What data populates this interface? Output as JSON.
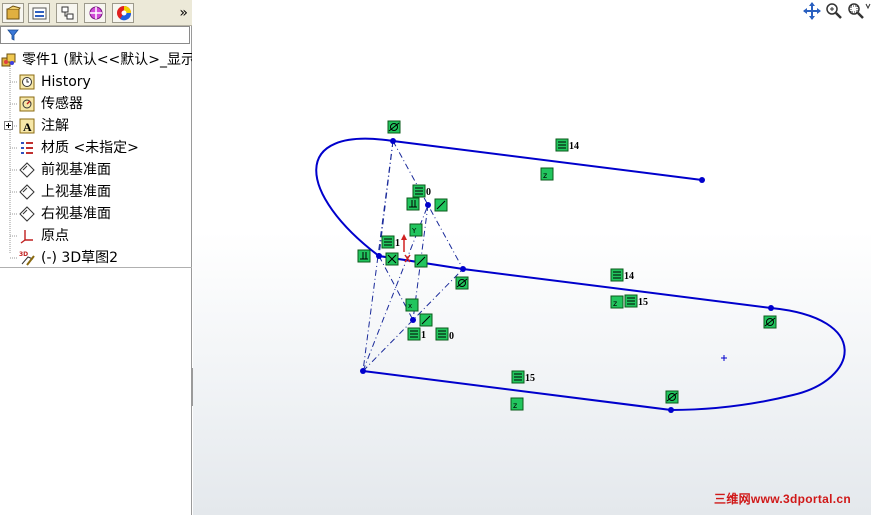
{
  "feature_manager": {
    "tabs": [
      {
        "name": "featuremanager-tab"
      },
      {
        "name": "propertymanager-tab"
      },
      {
        "name": "configurationmanager-tab"
      },
      {
        "name": "dimxpert-tab"
      },
      {
        "name": "display-manager-tab"
      }
    ],
    "expand_glyph": "»",
    "part_label": "零件1  (默认<<默认>_显示",
    "items": [
      {
        "label": "History",
        "icon": "history-icon"
      },
      {
        "label": "传感器",
        "icon": "sensor-icon"
      },
      {
        "label": "注解",
        "icon": "annotation-icon"
      },
      {
        "label": "材质 <未指定>",
        "icon": "material-icon"
      },
      {
        "label": "前视基准面",
        "icon": "plane-icon"
      },
      {
        "label": "上视基准面",
        "icon": "plane-icon"
      },
      {
        "label": "右视基准面",
        "icon": "plane-icon"
      },
      {
        "label": "原点",
        "icon": "origin-icon"
      },
      {
        "label": "(-) 3D草图2",
        "icon": "3d-sketch-icon"
      }
    ]
  },
  "viewport": {
    "tools": [
      "pan-icon",
      "zoom-in-icon",
      "zoom-to-fit-icon"
    ],
    "relation_labels": [
      "14",
      "0",
      "1",
      "14",
      "15",
      "1",
      "0",
      "15"
    ],
    "watermark": "三维网www.3dportal.cn"
  },
  "colors": {
    "sketch": "#0000cc",
    "relation_icon": "#22c55e",
    "watermark": "#d01818"
  }
}
